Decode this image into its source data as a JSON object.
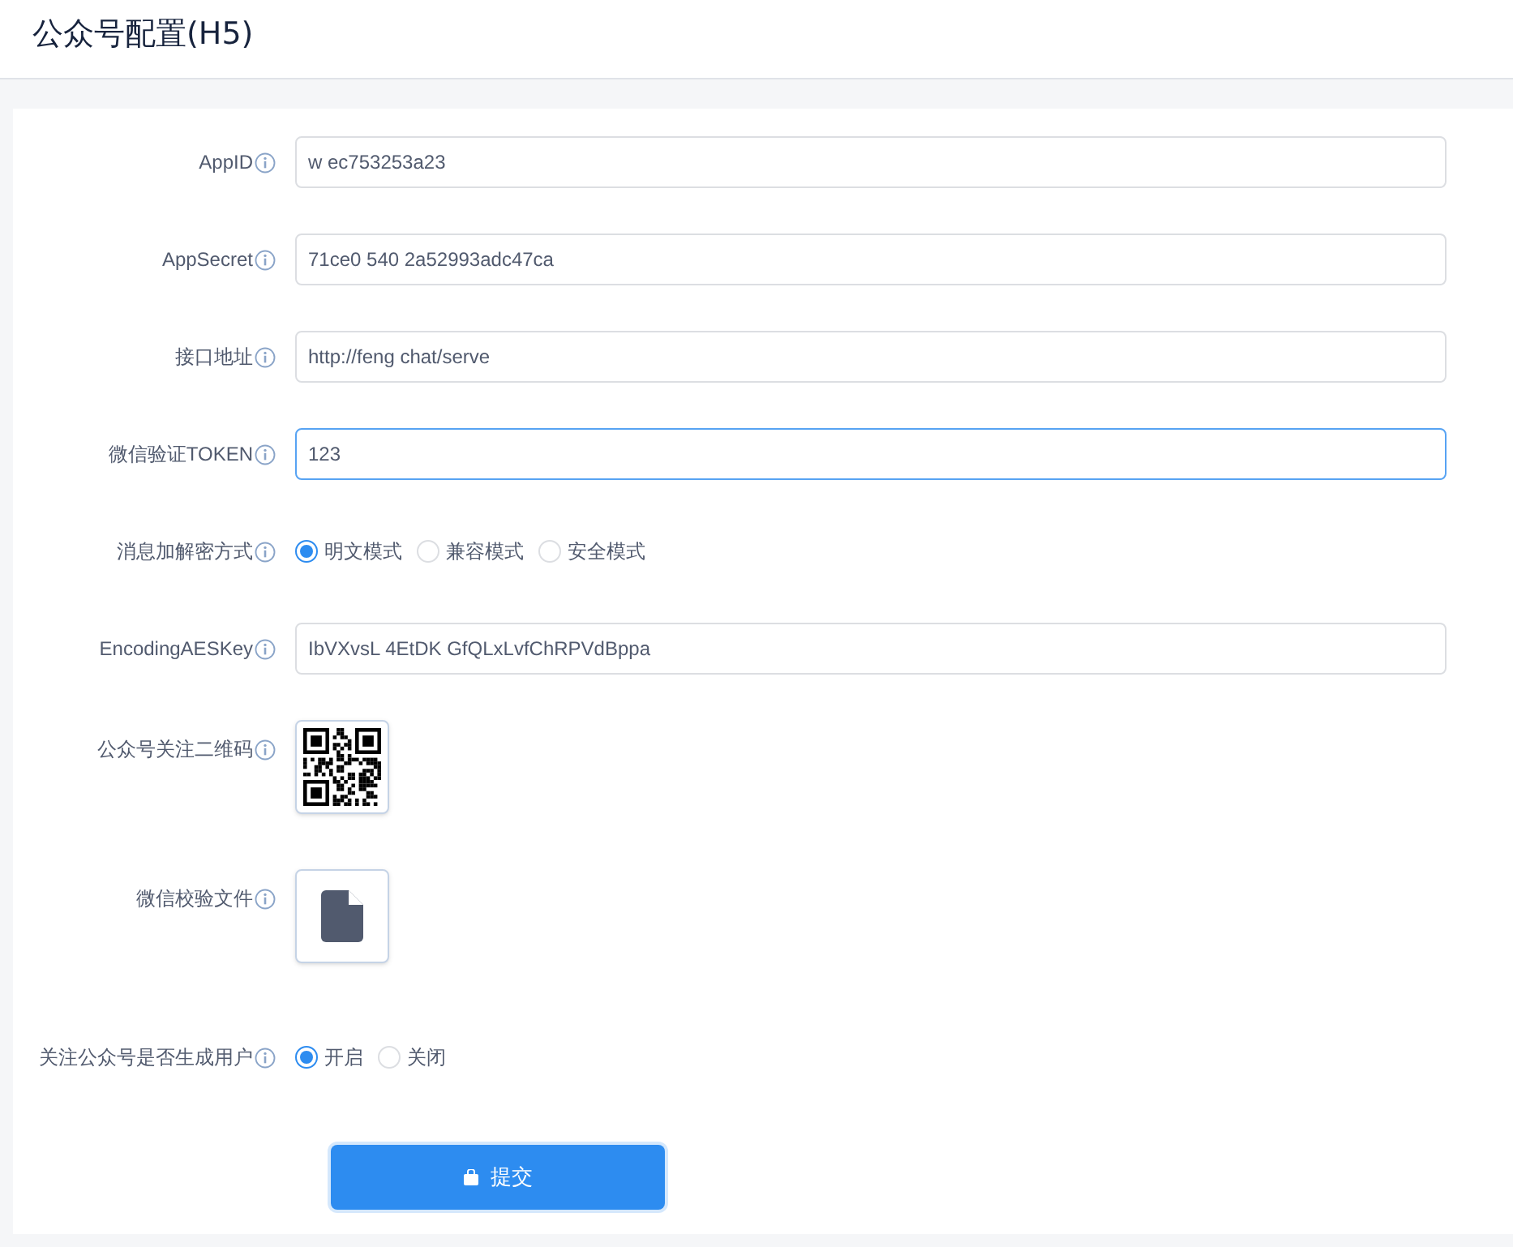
{
  "header": {
    "title": "公众号配置(H5)"
  },
  "fields": [
    {
      "kind": "input",
      "label": "AppID",
      "value": "w ec753253a23",
      "focused": false
    },
    {
      "kind": "input",
      "label": "AppSecret",
      "value": "71ce0 540 2a52993adc47ca",
      "focused": false
    },
    {
      "kind": "input",
      "label": "接口地址",
      "value": "http://feng chat/serve",
      "focused": false
    },
    {
      "kind": "input",
      "label": "微信验证TOKEN",
      "value": "123",
      "focused": true
    },
    {
      "kind": "radio",
      "label": "消息加解密方式",
      "options": [
        {
          "label": "明文模式",
          "selected": true
        },
        {
          "label": "兼容模式",
          "selected": false
        },
        {
          "label": "安全模式",
          "selected": false
        }
      ]
    },
    {
      "kind": "input",
      "label": "EncodingAESKey",
      "value": "IbVXvsL 4EtDK GfQLxLvfChRPVdBppa",
      "focused": false
    },
    {
      "kind": "qrcode",
      "label": "公众号关注二维码"
    },
    {
      "kind": "file",
      "label": "微信校验文件"
    },
    {
      "kind": "radio",
      "label": "关注公众号是否生成用户",
      "options": [
        {
          "label": "开启",
          "selected": true
        },
        {
          "label": "关闭",
          "selected": false
        }
      ]
    }
  ],
  "submit": {
    "label": "提交"
  }
}
